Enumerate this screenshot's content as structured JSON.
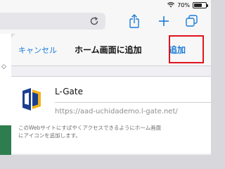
{
  "status_bar": {
    "battery_text": "70%",
    "battery_level": 0.7
  },
  "toolbar": {
    "icons": [
      "reload-icon",
      "share-icon",
      "plus-icon",
      "tabs-icon"
    ]
  },
  "sheet": {
    "cancel_label": "キャンセル",
    "title": "ホーム画面に追加",
    "add_label": "追加",
    "app_name": "L-Gate",
    "app_url": "https://aad-uchidademo.l-gate.net/",
    "description_line1": "このWebサイトにすばやくアクセスできるようにホーム画面",
    "description_line2": "にアイコンを追加します。"
  },
  "colors": {
    "accent": "#1a7bd8",
    "highlight": "#e0141e",
    "icon_blue": "#1b3f8f",
    "icon_gold": "#f2b21a"
  }
}
